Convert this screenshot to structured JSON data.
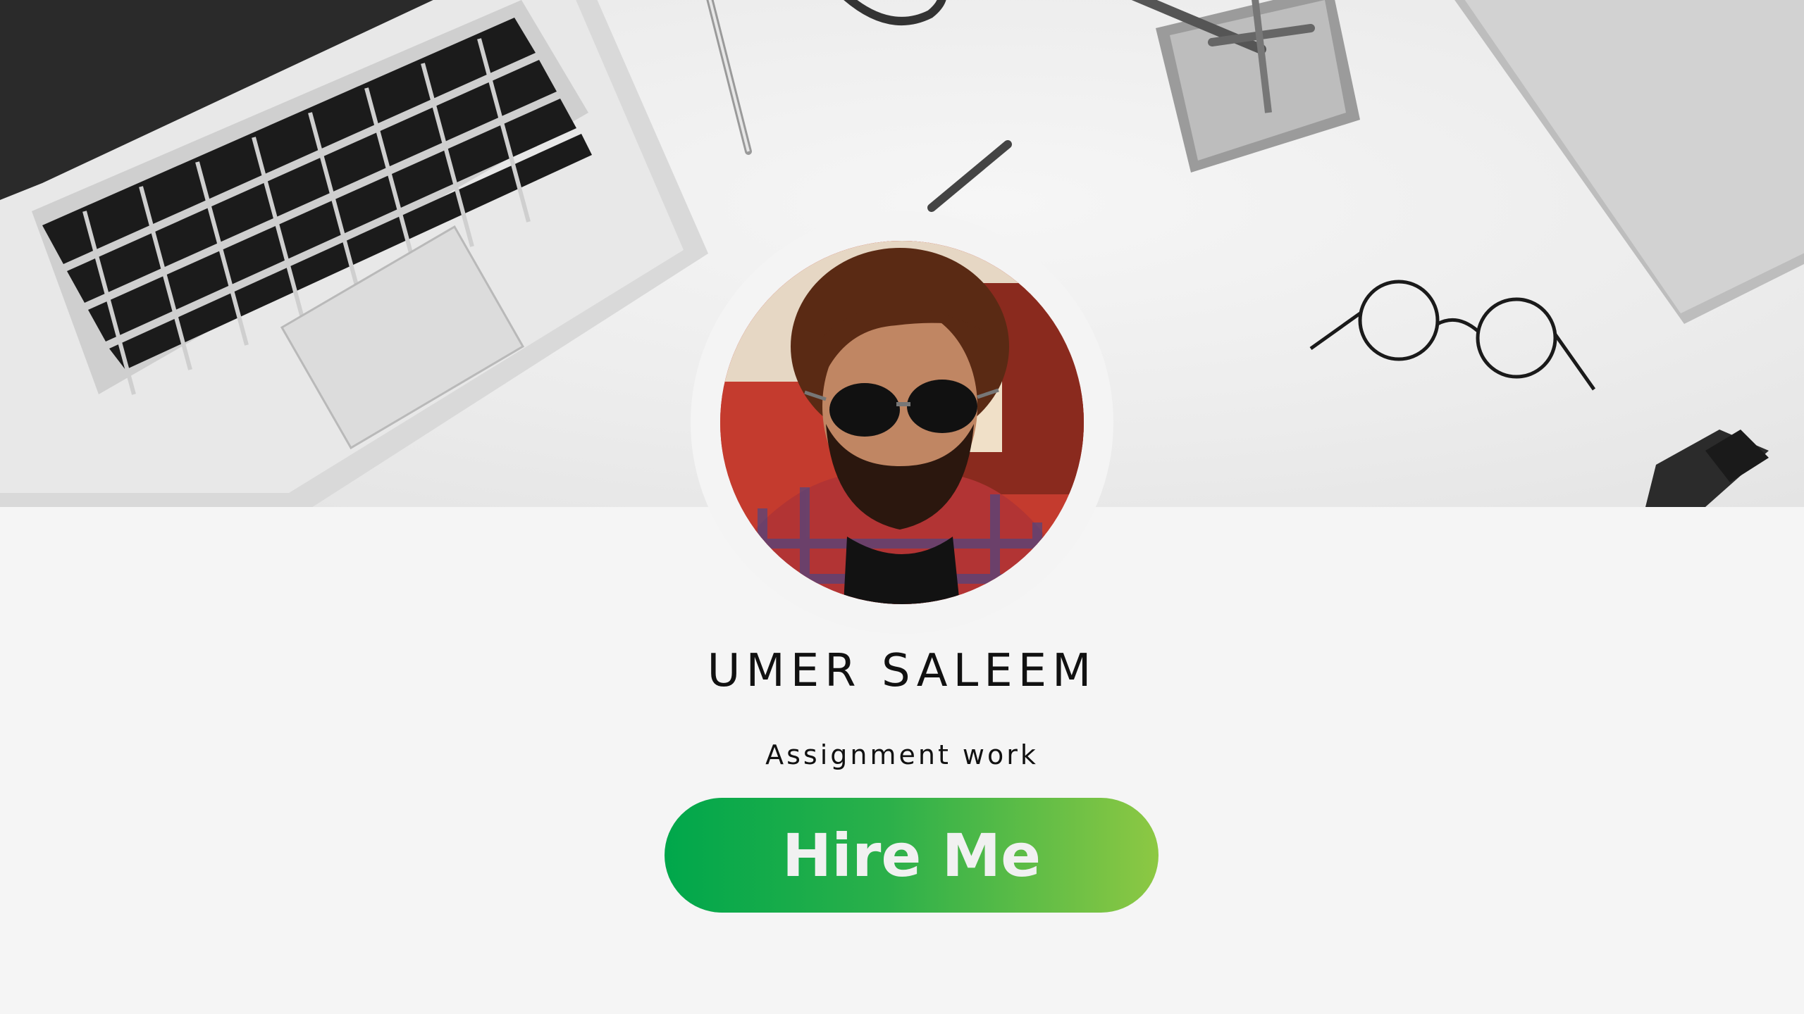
{
  "profile": {
    "name": "UMER SALEEM",
    "subtitle": "Assignment work"
  },
  "cta": {
    "label": "Hire Me"
  },
  "colors": {
    "background": "#f5f5f5",
    "button_gradient_start": "#00a74b",
    "button_gradient_end": "#8dc843",
    "button_text": "#f1f1f1",
    "text": "#111111"
  },
  "hero": {
    "icons": [
      "laptop-icon",
      "pen-icon",
      "pencil-holder-icon",
      "glasses-icon",
      "notebook-icon",
      "usb-drive-icon"
    ]
  }
}
